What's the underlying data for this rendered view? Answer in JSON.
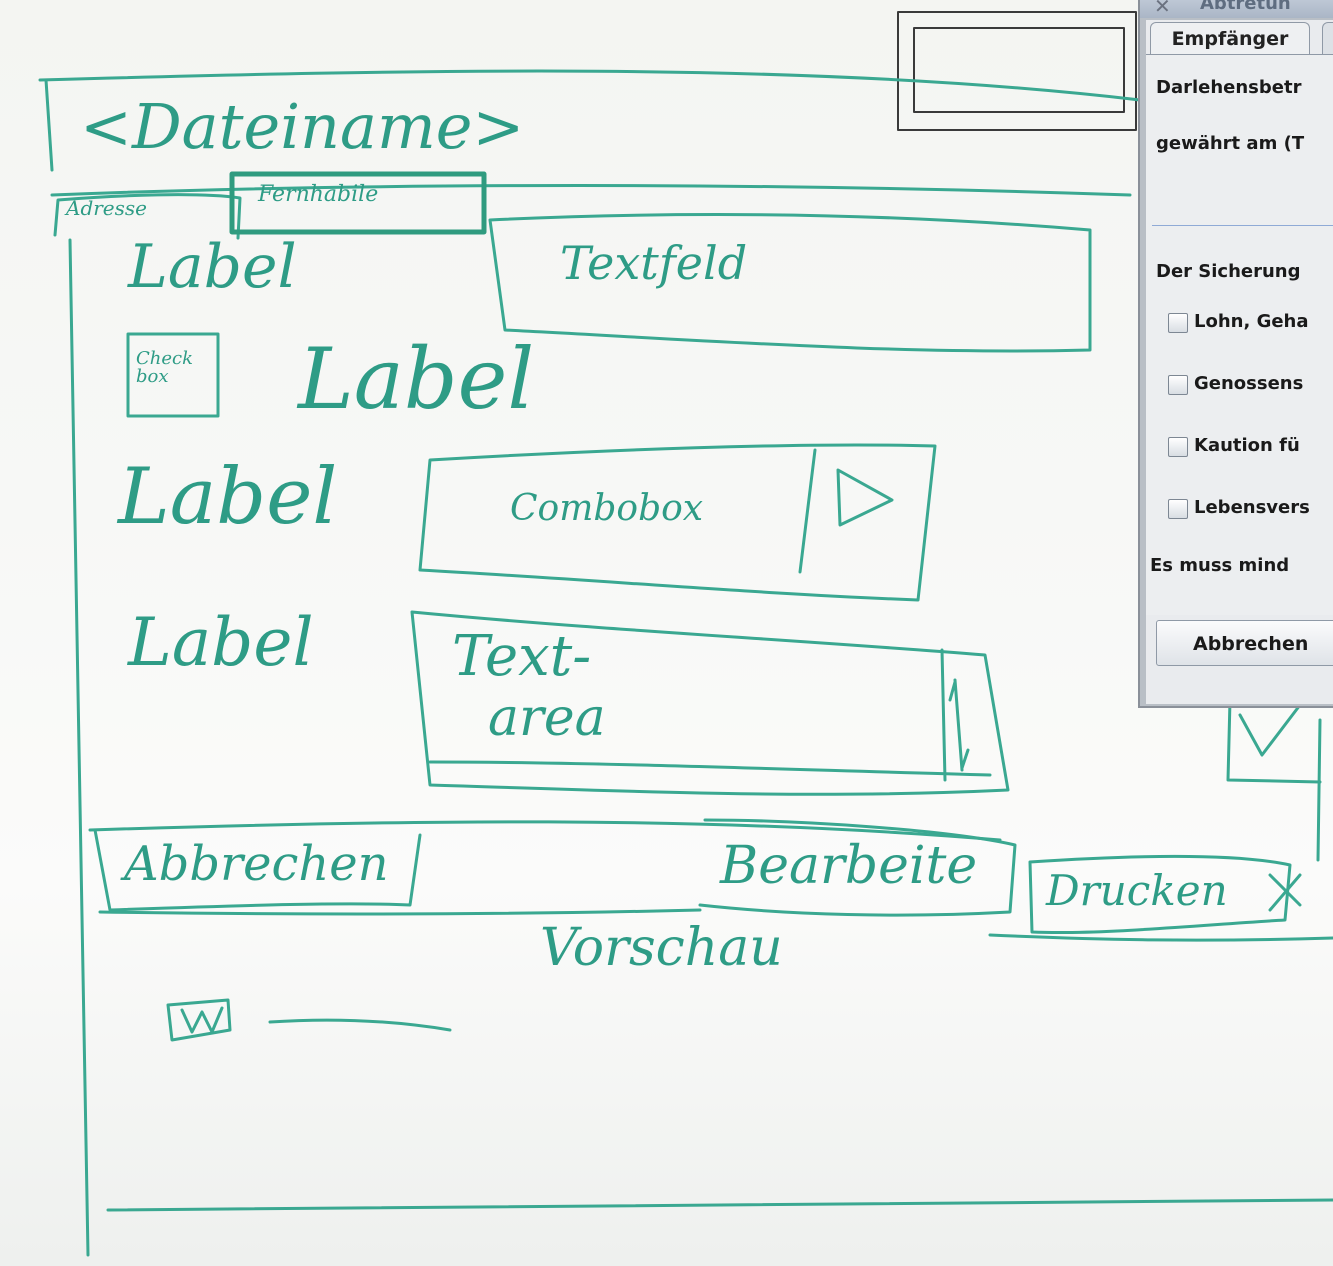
{
  "sketch": {
    "filename": "<Dateiname>",
    "tab_address": "Adresse",
    "tab_second": "Fernhabile",
    "label_1": "Label",
    "textfield": "Textfeld",
    "checkbox": "Check box",
    "label_2": "Label",
    "label_3": "Label",
    "combobox": "Combobox",
    "label_4": "Label",
    "textarea_1": "Text-",
    "textarea_2": "area",
    "btn_cancel": "Abbrechen",
    "btn_edit": "Bearbeite",
    "btn_print": "Drucken",
    "preview": "Vorschau"
  },
  "dialog": {
    "title": "Abtretun",
    "tab_active": "Empfänger",
    "amount_label": "Darlehensbetr",
    "granted_label": "gewährt am (T",
    "security_label": "Der Sicherung",
    "checkboxes": [
      {
        "label": "Lohn, Geha",
        "checked": false
      },
      {
        "label": "Genossens",
        "checked": false
      },
      {
        "label": "Kaution fü",
        "checked": false
      },
      {
        "label": "Lebensvers",
        "checked": false
      }
    ],
    "hint": "Es muss mind",
    "cancel_button": "Abbrechen"
  }
}
